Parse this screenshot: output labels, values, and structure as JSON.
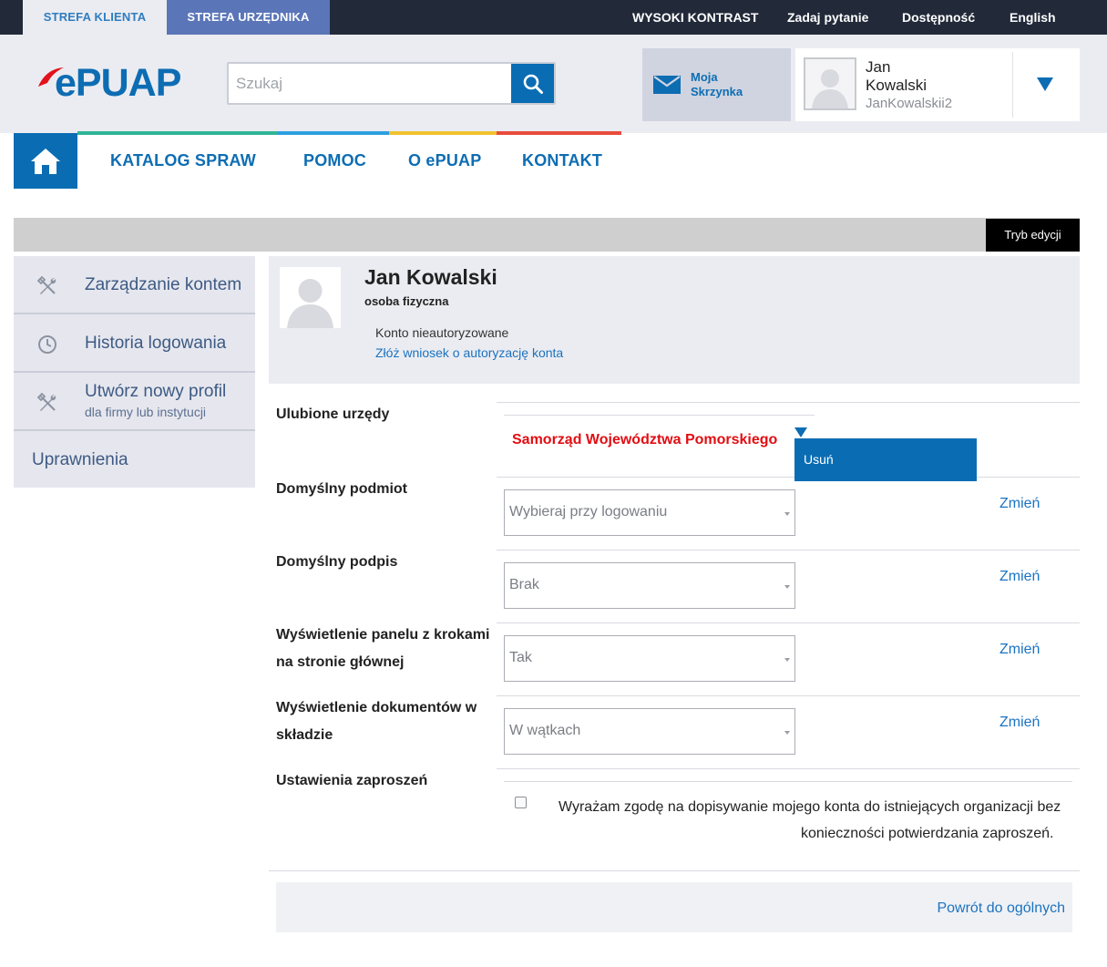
{
  "topbar": {
    "zone_client": "STREFA KLIENTA",
    "zone_official": "STREFA URZĘDNIKA",
    "high_contrast": "WYSOKI KONTRAST",
    "ask_question": "Zadaj pytanie",
    "accessibility": "Dostępność",
    "language": "English"
  },
  "header": {
    "logo_text": "ePUAP",
    "search_placeholder": "Szukaj",
    "mailbox_line1": "Moja",
    "mailbox_line2": "Skrzynka",
    "user_first_name": "Jan",
    "user_last_name": "Kowalski",
    "user_login": "JanKowalskii2"
  },
  "nav": {
    "items": [
      "KATALOG SPRAW",
      "POMOC",
      "O ePUAP",
      "KONTAKT"
    ],
    "stripe_colors": [
      "#2fb596",
      "#2d9fe0",
      "#f0c22e",
      "#e84b3c"
    ]
  },
  "editbar": {
    "mode_button": "Tryb edycji"
  },
  "sidebar": {
    "items": [
      {
        "label": "Zarządzanie kontem",
        "icon": "tools-icon"
      },
      {
        "label": "Historia logowania",
        "icon": "clock-icon"
      },
      {
        "label": "Utwórz nowy profil",
        "sub": "dla firmy lub instytucji",
        "icon": "tools-icon"
      },
      {
        "label": "Uprawnienia"
      }
    ]
  },
  "profile": {
    "name": "Jan Kowalski",
    "type": "osoba fizyczna",
    "status": "Konto nieautoryzowane",
    "auth_link": "Złóż wniosek o autoryzację konta"
  },
  "settings": {
    "favorites": {
      "label": "Ulubione urzędy",
      "office": "Samorząd Województwa Pomorskiego",
      "menu_item": "Usuń"
    },
    "default_entity": {
      "label": "Domyślny podmiot",
      "value": "Wybieraj przy logowaniu",
      "change": "Zmień"
    },
    "default_signature": {
      "label": "Domyślny podpis",
      "value": "Brak",
      "change": "Zmień"
    },
    "steps_panel": {
      "label_line1": "Wyświetlenie panelu z krokami",
      "label_line2": "na stronie głównej",
      "value": "Tak",
      "change": "Zmień"
    },
    "documents_view": {
      "label_line1": "Wyświetlenie dokumentów w",
      "label_line2": "składzie",
      "value": "W wątkach",
      "change": "Zmień"
    },
    "invitations": {
      "label": "Ustawienia zaproszeń",
      "consent_line1": "Wyrażam zgodę na dopisywanie mojego konta do istniejących organizacji bez",
      "consent_line2": "konieczności potwierdzania zaproszeń.",
      "checked": false
    }
  },
  "footer": {
    "back_link": "Powrót do ogólnych"
  },
  "colors": {
    "primary_blue": "#0a6db4",
    "link_blue": "#1b73c1",
    "alert_red": "#e20d12",
    "topbar_dark": "#222a3a"
  }
}
